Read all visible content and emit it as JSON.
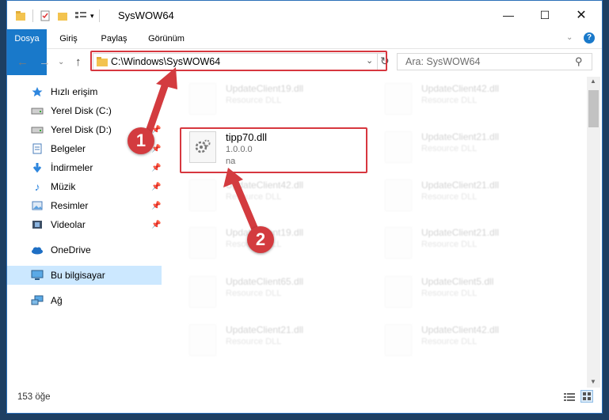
{
  "window": {
    "title": "SysWOW64"
  },
  "ribbon": {
    "tabs": [
      "Dosya",
      "Giriş",
      "Paylaş",
      "Görünüm"
    ]
  },
  "address": {
    "path": "C:\\Windows\\SysWOW64"
  },
  "search": {
    "placeholder": "Ara: SysWOW64"
  },
  "sidebar": {
    "items": [
      {
        "label": "Hızlı erişim",
        "icon": "star-icon"
      },
      {
        "label": "Yerel Disk (C:)",
        "icon": "drive-icon"
      },
      {
        "label": "Yerel Disk (D:)",
        "icon": "drive-icon"
      },
      {
        "label": "Belgeler",
        "icon": "documents-icon"
      },
      {
        "label": "İndirmeler",
        "icon": "download-icon"
      },
      {
        "label": "Müzik",
        "icon": "music-icon"
      },
      {
        "label": "Resimler",
        "icon": "pictures-icon"
      },
      {
        "label": "Videolar",
        "icon": "videos-icon"
      },
      {
        "label": "OneDrive",
        "icon": "cloud-icon"
      },
      {
        "label": "Bu bilgisayar",
        "icon": "computer-icon"
      },
      {
        "label": "Ağ",
        "icon": "network-icon"
      }
    ]
  },
  "files": {
    "highlighted": {
      "name": "tipp70.dll",
      "version": "1.0.0.0",
      "desc": "na"
    },
    "left": [
      {
        "name": "UpdateClient19.dll",
        "desc": "Resource DLL"
      },
      {
        "name": "UpdateClient42.dll",
        "desc": "Resource DLL"
      },
      {
        "name": "UpdateClient19.dll",
        "desc": "Resource DLL"
      },
      {
        "name": "UpdateClient65.dll",
        "desc": "Resource DLL"
      },
      {
        "name": "UpdateClient21.dll",
        "desc": "Resource DLL"
      }
    ],
    "right": [
      {
        "name": "UpdateClient42.dll",
        "desc": "Resource DLL"
      },
      {
        "name": "UpdateClient21.dll",
        "desc": "Resource DLL"
      },
      {
        "name": "UpdateClient21.dll",
        "desc": "Resource DLL"
      },
      {
        "name": "UpdateClient21.dll",
        "desc": "Resource DLL"
      },
      {
        "name": "UpdateClient5.dll",
        "desc": "Resource DLL"
      },
      {
        "name": "UpdateClient42.dll",
        "desc": "Resource DLL"
      }
    ]
  },
  "status": {
    "count": "153 öğe"
  },
  "annotations": {
    "badge1": "1",
    "badge2": "2"
  },
  "colors": {
    "accent": "#1979ca",
    "highlight": "#d7373f",
    "selected": "#cce8ff"
  }
}
